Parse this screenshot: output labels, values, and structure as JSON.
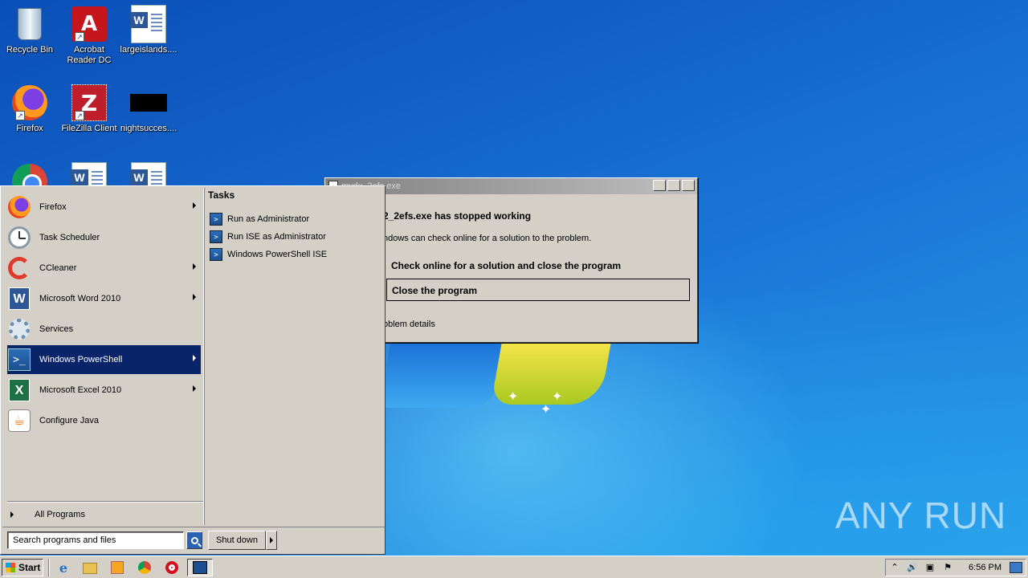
{
  "desktop": {
    "icons": [
      {
        "label": "Recycle Bin",
        "icon": "recycle-bin-icon"
      },
      {
        "label": "Acrobat Reader DC",
        "icon": "acrobat-icon"
      },
      {
        "label": "largeislands....",
        "icon": "word-doc-icon"
      },
      {
        "label": "Firefox",
        "icon": "firefox-icon"
      },
      {
        "label": "FileZilla Client",
        "icon": "filezilla-icon"
      },
      {
        "label": "nightsucces....",
        "icon": "black-file-icon"
      },
      {
        "label": "",
        "icon": "chrome-icon"
      },
      {
        "label": "",
        "icon": "word-doc-icon"
      },
      {
        "label": "",
        "icon": "word-doc-icon"
      }
    ],
    "watermark": "ANY RUN"
  },
  "dialog": {
    "title": "mydx_2efs.exe",
    "heading": "2_2efs.exe has stopped working",
    "subtext": "ndows can check online for a solution to the problem.",
    "option_check": "Check online for a solution and close the program",
    "option_close": "Close the program",
    "details": "oblem details",
    "btn_min": "_",
    "btn_max": "□",
    "btn_close": "✕"
  },
  "start_menu": {
    "items": [
      {
        "label": "Firefox",
        "icon": "firefox-icon",
        "submenu": true
      },
      {
        "label": "Task Scheduler",
        "icon": "clock-icon",
        "submenu": false
      },
      {
        "label": "CCleaner",
        "icon": "ccleaner-icon",
        "submenu": true
      },
      {
        "label": "Microsoft Word 2010",
        "icon": "word-icon",
        "submenu": true
      },
      {
        "label": "Services",
        "icon": "gear-icon",
        "submenu": false
      },
      {
        "label": "Windows PowerShell",
        "icon": "powershell-icon",
        "submenu": true,
        "selected": true
      },
      {
        "label": "Microsoft Excel 2010",
        "icon": "excel-icon",
        "submenu": true
      },
      {
        "label": "Configure Java",
        "icon": "java-icon",
        "submenu": false
      }
    ],
    "all_programs": "All Programs",
    "search_placeholder": "Search programs and files",
    "shutdown": "Shut down",
    "tasks_title": "Tasks",
    "tasks": [
      {
        "label": "Run as Administrator",
        "icon": "powershell-icon"
      },
      {
        "label": "Run ISE as Administrator",
        "icon": "powershell-ise-icon"
      },
      {
        "label": "Windows PowerShell ISE",
        "icon": "powershell-ise-icon"
      }
    ]
  },
  "taskbar": {
    "start_label": "Start",
    "pinned": [
      "ie-icon",
      "folder-icon",
      "media-player-icon",
      "chrome-icon",
      "opera-icon"
    ],
    "active_window_icon": "powershell-window-icon",
    "tray_icons": [
      "chevron-up-icon",
      "volume-icon",
      "network-icon",
      "flag-icon"
    ],
    "clock": "6:56 PM",
    "show_desktop": "show-desktop-icon"
  }
}
